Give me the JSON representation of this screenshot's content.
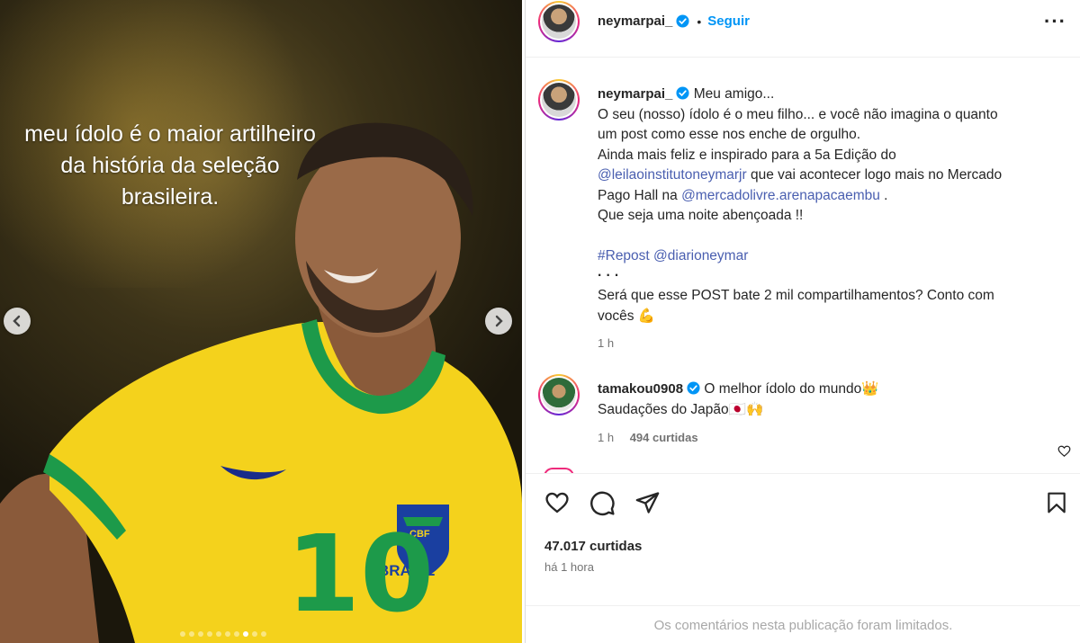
{
  "media": {
    "caption_lines": [
      "meu ídolo é o maior artilheiro",
      "da história da seleção",
      "brasileira."
    ],
    "jersey_number": "10",
    "jersey_badge": "CBF",
    "jersey_text": "BRASIL",
    "slide_count": 10,
    "active_slide": 7
  },
  "header": {
    "username": "neymarpai_",
    "separator": "•",
    "follow_label": "Seguir",
    "more_label": "···"
  },
  "post": {
    "username": "neymarpai_",
    "lines": {
      "l1": "Meu amigo...",
      "l2": "O seu (nosso) ídolo é o meu filho... e você não imagina o quanto",
      "l3": "um post como esse nos enche de orgulho.",
      "l4": "Ainda mais feliz e inspirado para a 5a Edição do",
      "mention1": "@leilaoinstitutoneymarjr",
      "l5_after": " que vai acontecer logo mais no Mercado",
      "l6_before": "Pago Hall na ",
      "mention2": "@mercadolivre.arenapacaembu",
      "l6_after": " .",
      "l7": "Que seja uma noite abençoada !!",
      "hashtag": "#Repost",
      "mention3": "@diarioneymar",
      "dots": "·   ·   ·",
      "l8": "Será que esse POST bate 2 mil compartilhamentos? Conto com",
      "l9": "vocês 💪"
    },
    "time": "1 h"
  },
  "comment": {
    "username": "tamakou0908",
    "text1": "O melhor ídolo do mundo👑",
    "text2": "Saudações do Japão🇯🇵🙌",
    "time": "1 h",
    "likes": "494 curtidas"
  },
  "footer": {
    "likes": "47.017 curtidas",
    "time": "há 1 hora",
    "limited_notice": "Os comentários nesta publicação foram limitados."
  },
  "colors": {
    "accent": "#0095f6",
    "link": "#4a5fb0",
    "jersey_yellow": "#f4d21c",
    "jersey_green": "#1d9a4a"
  }
}
